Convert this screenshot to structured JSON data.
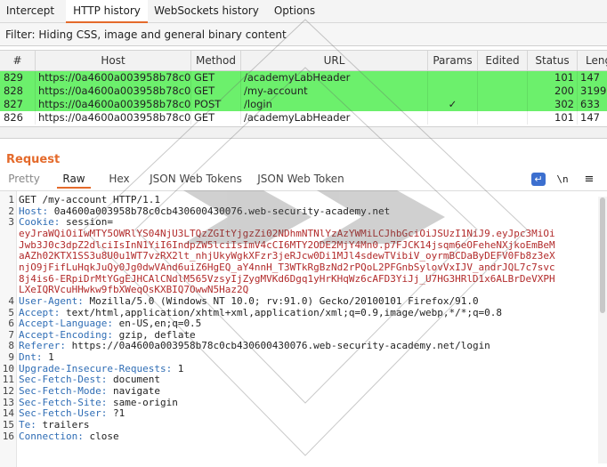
{
  "tabs": [
    {
      "label": "Intercept",
      "active": false
    },
    {
      "label": "HTTP history",
      "active": true
    },
    {
      "label": "WebSockets history",
      "active": false
    },
    {
      "label": "Options",
      "active": false
    }
  ],
  "filter": {
    "text": "Filter: Hiding CSS, image and general binary content"
  },
  "table": {
    "headers": [
      "#",
      "Host",
      "Method",
      "URL",
      "Params",
      "Edited",
      "Status",
      "Leng"
    ],
    "rows": [
      {
        "num": "829",
        "host": "https://0a4600a003958b78c0c...",
        "method": "GET",
        "url": "/academyLabHeader",
        "params": "",
        "edited": "",
        "status": "101",
        "length": "147",
        "highlight": "green"
      },
      {
        "num": "828",
        "host": "https://0a4600a003958b78c0c...",
        "method": "GET",
        "url": "/my-account",
        "params": "",
        "edited": "",
        "status": "200",
        "length": "3199",
        "highlight": "green"
      },
      {
        "num": "827",
        "host": "https://0a4600a003958b78c0c...",
        "method": "POST",
        "url": "/login",
        "params": "✓",
        "edited": "",
        "status": "302",
        "length": "633",
        "highlight": "green"
      },
      {
        "num": "826",
        "host": "https://0a4600a003958b78c0c...",
        "method": "GET",
        "url": "/academyLabHeader",
        "params": "",
        "edited": "",
        "status": "101",
        "length": "147",
        "highlight": "white"
      }
    ]
  },
  "request": {
    "title": "Request",
    "subtabs": [
      "Pretty",
      "Raw",
      "Hex",
      "JSON Web Tokens",
      "JSON Web Token"
    ],
    "active_subtab": "Raw",
    "toolbar_newline": "\\n",
    "toolbar_menu": "≡",
    "lines": [
      {
        "n": "1",
        "key": "",
        "val": "GET /my-account HTTP/1.1"
      },
      {
        "n": "2",
        "key": "Host:",
        "val": " 0a4600a003958b78c0cb430600430076.web-security-academy.net"
      },
      {
        "n": "3",
        "key": "Cookie:",
        "val": " session="
      },
      {
        "n": "",
        "key": "",
        "val": "eyJraWQiOiIwMTY5OWRlYS04NjU3LTQzZGItYjgzZi02NDhmNTNlYzAzYWMiLCJhbGciOiJSUzI1NiJ9.eyJpc3MiOi",
        "cookie": true
      },
      {
        "n": "",
        "key": "",
        "val": "Jwb3J0c3dpZ2dlciIsInN1YiI6IndpZW5lciIsImV4cCI6MTY2ODE2MjY4Mn0.p7FJCK14jsqm6eOFeheNXjkoEmBeM",
        "cookie": true
      },
      {
        "n": "",
        "key": "",
        "val": "aAZh02KTX1SS3u8U0u1WT7vzRX2lt_nhjUkyWgkXFzr3jeRJcw0Di1MJl4sdewTVibiV_oyrmBCDaByDEFV0Fb8z3eX",
        "cookie": true
      },
      {
        "n": "",
        "key": "",
        "val": "njO9jFifLuHqkJuQy0Jg0dwVAnd6uiZ6HgEQ_aY4nnH_T3WTkRgBzNd2rPQoL2PFGnbSylovVxIJV_andrJQL7c7svc",
        "cookie": true
      },
      {
        "n": "",
        "key": "",
        "val": "8j4is6-ERpiDrMtYGgEJHCAlCNdlM565VzsyIjZygMVKd6Dgq1yHrKHqWz6cAFD3YiJj_U7HG3HRlD1x6ALBrDeVXPH",
        "cookie": true
      },
      {
        "n": "",
        "key": "",
        "val": "LXeIQRVcuHHwkw9fbXWeqOsKXBIQ7OwwN5Haz2Q",
        "cookie": true
      },
      {
        "n": "4",
        "key": "User-Agent:",
        "val": " Mozilla/5.0 (Windows NT 10.0; rv:91.0) Gecko/20100101 Firefox/91.0"
      },
      {
        "n": "5",
        "key": "Accept:",
        "val": " text/html,application/xhtml+xml,application/xml;q=0.9,image/webp,*/*;q=0.8"
      },
      {
        "n": "6",
        "key": "Accept-Language:",
        "val": " en-US,en;q=0.5"
      },
      {
        "n": "7",
        "key": "Accept-Encoding:",
        "val": " gzip, deflate"
      },
      {
        "n": "8",
        "key": "Referer:",
        "val": " https://0a4600a003958b78c0cb430600430076.web-security-academy.net/login"
      },
      {
        "n": "9",
        "key": "Dnt:",
        "val": " 1"
      },
      {
        "n": "10",
        "key": "Upgrade-Insecure-Requests:",
        "val": " 1"
      },
      {
        "n": "11",
        "key": "Sec-Fetch-Dest:",
        "val": " document"
      },
      {
        "n": "12",
        "key": "Sec-Fetch-Mode:",
        "val": " navigate"
      },
      {
        "n": "13",
        "key": "Sec-Fetch-Site:",
        "val": " same-origin"
      },
      {
        "n": "14",
        "key": "Sec-Fetch-User:",
        "val": " ?1"
      },
      {
        "n": "15",
        "key": "Te:",
        "val": " trailers"
      },
      {
        "n": "16",
        "key": "Connection:",
        "val": " close"
      }
    ]
  },
  "colors": {
    "accent": "#e46a2b",
    "highlight_green": "#6cf06c",
    "header_key": "#2f6db5",
    "cookie_value": "#b22b2b"
  }
}
